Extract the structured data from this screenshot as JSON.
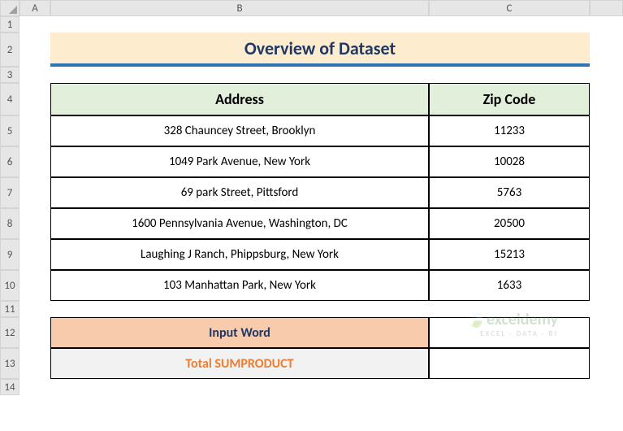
{
  "columns": [
    "A",
    "B",
    "C"
  ],
  "rows": [
    "1",
    "2",
    "3",
    "4",
    "5",
    "6",
    "7",
    "8",
    "9",
    "10",
    "11",
    "12",
    "13",
    "14"
  ],
  "title": "Overview of Dataset",
  "headers": {
    "address": "Address",
    "zip": "Zip Code"
  },
  "chart_data": {
    "type": "table",
    "columns": [
      "Address",
      "Zip Code"
    ],
    "rows": [
      [
        "328 Chauncey Street, Brooklyn",
        "11233"
      ],
      [
        "1049 Park Avenue, New York",
        "10028"
      ],
      [
        "69 park Street, Pittsford",
        "5763"
      ],
      [
        "1600 Pennsylvania Avenue, Washington, DC",
        "20500"
      ],
      [
        "Laughing J Ranch, Phippsburg, New York",
        "15213"
      ],
      [
        "103 Manhattan Park, New York",
        "1633"
      ]
    ]
  },
  "labels": {
    "input": "Input Word",
    "sum": "Total SUMPRODUCT"
  },
  "values": {
    "input": "",
    "sum": ""
  },
  "watermark": {
    "brand": "exceldemy",
    "tag": "EXCEL · DATA · BI"
  }
}
